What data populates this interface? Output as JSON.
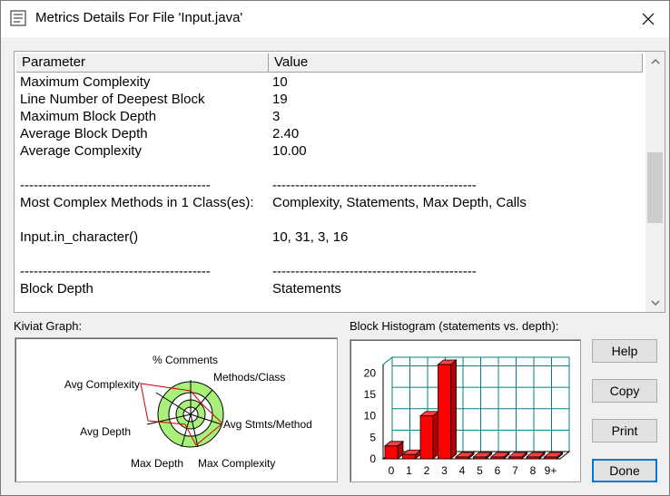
{
  "window": {
    "title": "Metrics Details For File 'Input.java'"
  },
  "table": {
    "headers": {
      "parameter": "Parameter",
      "value": "Value"
    },
    "rows": [
      {
        "param": "Maximum Complexity",
        "value": "10"
      },
      {
        "param": "Line Number of Deepest Block",
        "value": "19"
      },
      {
        "param": "Maximum Block Depth",
        "value": "3"
      },
      {
        "param": "Average Block Depth",
        "value": "2.40"
      },
      {
        "param": "Average Complexity",
        "value": "10.00"
      },
      {
        "param": "",
        "value": ""
      },
      {
        "param": "------------------------------------------",
        "value": "---------------------------------------------"
      },
      {
        "param": "Most Complex Methods in 1 Class(es):",
        "value": "Complexity, Statements, Max Depth, Calls"
      },
      {
        "param": "",
        "value": ""
      },
      {
        "param": "Input.in_character()",
        "value": "10, 31, 3, 16"
      },
      {
        "param": "",
        "value": ""
      },
      {
        "param": "------------------------------------------",
        "value": "---------------------------------------------"
      },
      {
        "param": "Block Depth",
        "value": "Statements"
      }
    ]
  },
  "kiviat": {
    "label": "Kiviat Graph:",
    "axes": [
      "% Comments",
      "Methods/Class",
      "Avg Stmts/Method",
      "Max Complexity",
      "Max Depth",
      "Avg Depth",
      "Avg Complexity"
    ]
  },
  "histogram": {
    "label": "Block Histogram (statements vs. depth):",
    "chart_data": {
      "type": "bar",
      "categories": [
        "0",
        "1",
        "2",
        "3",
        "4",
        "5",
        "6",
        "7",
        "8",
        "9+"
      ],
      "values": [
        3,
        1,
        10,
        22,
        0,
        0,
        0,
        0,
        0,
        0
      ],
      "ylim": [
        0,
        22
      ],
      "yticks": [
        "0",
        "5",
        "10",
        "15",
        "20"
      ],
      "bar_color": "#ff0000",
      "grid_color": "#008080"
    }
  },
  "buttons": {
    "help": "Help",
    "copy": "Copy",
    "print": "Print",
    "done": "Done"
  }
}
